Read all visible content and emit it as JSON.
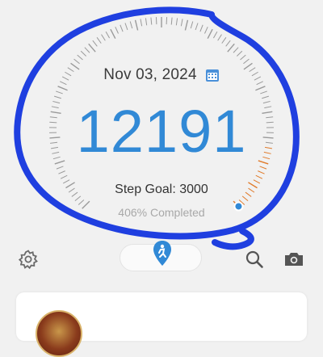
{
  "header": {
    "date": "Nov 03, 2024"
  },
  "main": {
    "step_count": "12191",
    "goal_text": "Step Goal: 3000",
    "completed_text": "406% Completed",
    "progress_fraction": 1.0
  },
  "toolbar": {
    "icons": [
      "gear-icon",
      "walk-mode-icon",
      "search-icon",
      "camera-icon"
    ]
  },
  "colors": {
    "accent": "#3189d6",
    "annotation": "#1f3fe0",
    "dial_tick": "#9a9a9a",
    "dial_progress": "#e07a2a",
    "background": "#f1f1f1"
  }
}
